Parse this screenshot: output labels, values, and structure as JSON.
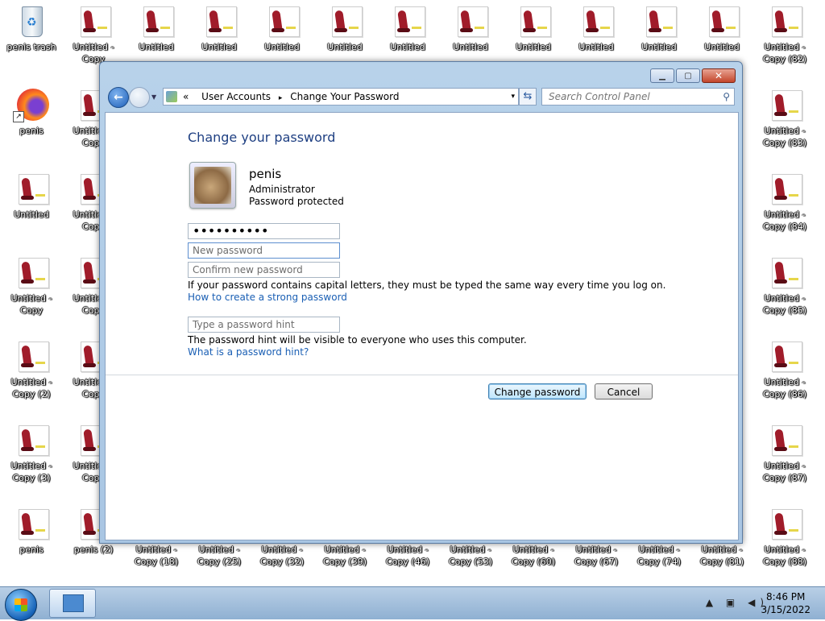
{
  "desktop": {
    "icons": [
      {
        "label": "penis trash",
        "type": "recycle-bin"
      },
      {
        "label": "Untitled - Copy",
        "type": "file"
      },
      {
        "label": "Untitled",
        "type": "file"
      },
      {
        "label": "Untitled",
        "type": "file"
      },
      {
        "label": "Untitled",
        "type": "file"
      },
      {
        "label": "Untitled",
        "type": "file"
      },
      {
        "label": "Untitled",
        "type": "file"
      },
      {
        "label": "Untitled",
        "type": "file"
      },
      {
        "label": "Untitled",
        "type": "file"
      },
      {
        "label": "Untitled",
        "type": "file"
      },
      {
        "label": "Untitled",
        "type": "file"
      },
      {
        "label": "Untitled",
        "type": "file"
      },
      {
        "label": "Untitled - Copy (82)",
        "type": "file"
      },
      {
        "label": "penis",
        "type": "firefox"
      },
      {
        "label": "Untitled - Copy",
        "type": "file"
      },
      {
        "label": "Untitled - Copy (83)",
        "type": "file"
      },
      {
        "label": "Untitled",
        "type": "file"
      },
      {
        "label": "Untitled - Copy",
        "type": "file"
      },
      {
        "label": "Untitled - Copy (84)",
        "type": "file"
      },
      {
        "label": "Untitled - Copy",
        "type": "file"
      },
      {
        "label": "Untitled - Copy",
        "type": "file"
      },
      {
        "label": "Untitled - Copy (85)",
        "type": "file"
      },
      {
        "label": "Untitled - Copy (2)",
        "type": "file"
      },
      {
        "label": "Untitled - Copy",
        "type": "file"
      },
      {
        "label": "Untitled - Copy (86)",
        "type": "file"
      },
      {
        "label": "Untitled - Copy (3)",
        "type": "file"
      },
      {
        "label": "Untitled - Copy",
        "type": "file"
      },
      {
        "label": "Untitled - Copy (87)",
        "type": "file"
      },
      {
        "label": "penis",
        "type": "file"
      },
      {
        "label": "penis (2)",
        "type": "file"
      },
      {
        "label": "Untitled - Copy (18)",
        "type": "file"
      },
      {
        "label": "Untitled - Copy (25)",
        "type": "file"
      },
      {
        "label": "Untitled - Copy (32)",
        "type": "file"
      },
      {
        "label": "Untitled - Copy (39)",
        "type": "file"
      },
      {
        "label": "Untitled - Copy (46)",
        "type": "file"
      },
      {
        "label": "Untitled - Copy (53)",
        "type": "file"
      },
      {
        "label": "Untitled - Copy (60)",
        "type": "file"
      },
      {
        "label": "Untitled - Copy (67)",
        "type": "file"
      },
      {
        "label": "Untitled - Copy (74)",
        "type": "file"
      },
      {
        "label": "Untitled - Copy (81)",
        "type": "file"
      },
      {
        "label": "Untitled - Copy (88)",
        "type": "file"
      }
    ]
  },
  "window": {
    "controls": {
      "minimize": "▁",
      "maximize": "▢",
      "close": "✕"
    },
    "address": {
      "overflow": "«",
      "crumb1": "User Accounts",
      "sep": "▸",
      "crumb2": "Change Your Password",
      "dropdown": "▾"
    },
    "refresh": "⇆",
    "search": {
      "placeholder": "Search Control Panel",
      "icon": "search-icon"
    },
    "title": "Change your password",
    "user": {
      "name": "penis",
      "role": "Administrator",
      "state": "Password protected"
    },
    "fields": {
      "current_value": "••••••••••",
      "new_placeholder": "New password",
      "confirm_placeholder": "Confirm new password",
      "hint_placeholder": "Type a password hint"
    },
    "notes": {
      "caps": "If your password contains capital letters, they must be typed the same way every time you log on.",
      "strong_link": "How to create a strong password",
      "hint_note": "The password hint will be visible to everyone who uses this computer.",
      "hint_link": "What is a password hint?"
    },
    "buttons": {
      "change": "Change password",
      "cancel": "Cancel"
    }
  },
  "taskbar": {
    "tray_icons": "▲ ▣ ◀)",
    "time": "8:46 PM",
    "date": "3/15/2022"
  }
}
